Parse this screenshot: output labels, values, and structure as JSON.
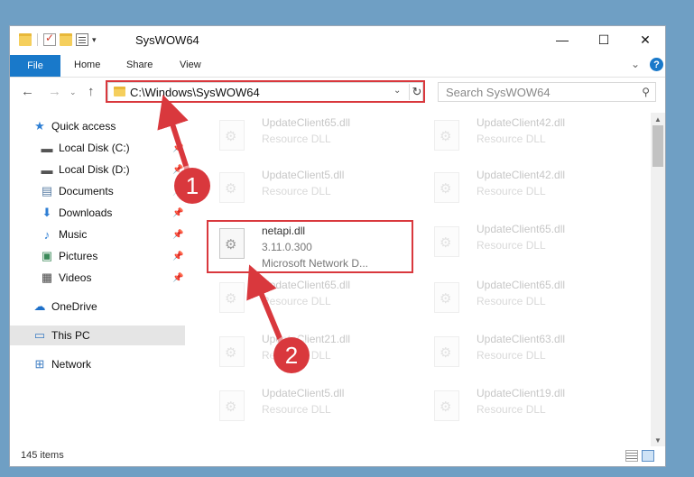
{
  "window": {
    "title": "SysWOW64"
  },
  "ribbon": {
    "file": "File",
    "home": "Home",
    "share": "Share",
    "view": "View"
  },
  "address": {
    "path": "C:\\Windows\\SysWOW64"
  },
  "search": {
    "placeholder": "Search SysWOW64"
  },
  "sidebar": {
    "items": [
      {
        "label": "Quick access",
        "icon": "star-icon"
      },
      {
        "label": "Local Disk (C:)",
        "icon": "drive-icon",
        "pinned": true
      },
      {
        "label": "Local Disk (D:)",
        "icon": "drive-icon",
        "pinned": true
      },
      {
        "label": "Documents",
        "icon": "documents-icon",
        "pinned": true
      },
      {
        "label": "Downloads",
        "icon": "download-icon",
        "pinned": true
      },
      {
        "label": "Music",
        "icon": "music-icon",
        "pinned": true
      },
      {
        "label": "Pictures",
        "icon": "pictures-icon",
        "pinned": true
      },
      {
        "label": "Videos",
        "icon": "videos-icon",
        "pinned": true
      },
      {
        "label": "OneDrive",
        "icon": "cloud-icon"
      },
      {
        "label": "This PC",
        "icon": "computer-icon",
        "selected": true
      },
      {
        "label": "Network",
        "icon": "network-icon"
      }
    ]
  },
  "files": {
    "highlighted": {
      "name": "netapi.dll",
      "version": "3.11.0.300",
      "description": "Microsoft Network D..."
    },
    "left": [
      {
        "name": "UpdateClient65.dll",
        "type": "Resource DLL"
      },
      {
        "name": "UpdateClient5.dll",
        "type": "Resource DLL"
      },
      {
        "name": "UpdateClient65.dll",
        "type": "Resource DLL"
      },
      {
        "name": "UpdateClient21.dll",
        "type": "Resource DLL"
      },
      {
        "name": "UpdateClient5.dll",
        "type": "Resource DLL"
      }
    ],
    "right": [
      {
        "name": "UpdateClient42.dll",
        "type": "Resource DLL"
      },
      {
        "name": "UpdateClient42.dll",
        "type": "Resource DLL"
      },
      {
        "name": "UpdateClient65.dll",
        "type": "Resource DLL"
      },
      {
        "name": "UpdateClient65.dll",
        "type": "Resource DLL"
      },
      {
        "name": "UpdateClient63.dll",
        "type": "Resource DLL"
      },
      {
        "name": "UpdateClient19.dll",
        "type": "Resource DLL"
      }
    ]
  },
  "status": {
    "item_count": "145 items"
  },
  "annotations": {
    "step1": "1",
    "step2": "2",
    "color": "#d9383d"
  }
}
